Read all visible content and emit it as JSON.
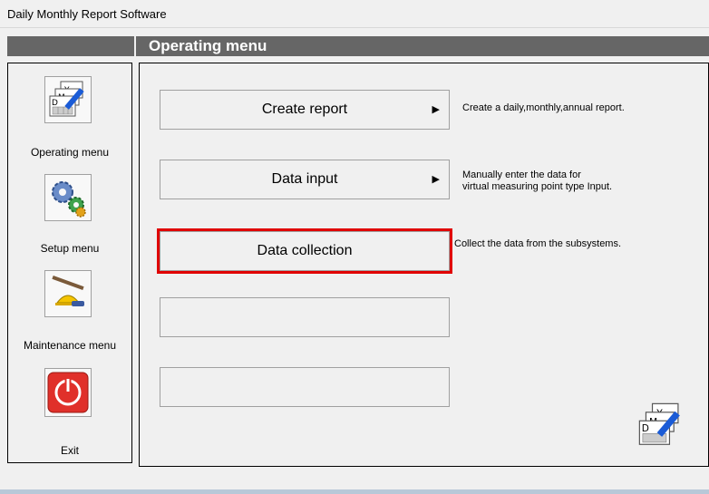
{
  "window": {
    "title": "Daily Monthly Report Software"
  },
  "header": {
    "title": "Operating menu"
  },
  "sidebar": {
    "items": [
      {
        "label": "Operating menu",
        "icon": "report-calendar-icon"
      },
      {
        "label": "Setup menu",
        "icon": "gears-icon"
      },
      {
        "label": "Maintenance menu",
        "icon": "tools-hardhat-icon"
      },
      {
        "label": "Exit",
        "icon": "power-icon"
      }
    ]
  },
  "main": {
    "buttons": [
      {
        "label": "Create report",
        "has_submenu": true,
        "description": "Create a daily,monthly,annual report."
      },
      {
        "label": "Data input",
        "has_submenu": true,
        "description_line1": "Manually enter the data for",
        "description_line2": "virtual measuring point type Input."
      },
      {
        "label": "Data collection",
        "has_submenu": false,
        "highlighted": true,
        "description": "Collect the data from the subsystems."
      },
      {
        "label": "",
        "has_submenu": false
      },
      {
        "label": "",
        "has_submenu": false
      }
    ],
    "submenu_arrow": "▶"
  },
  "colors": {
    "header_bg": "#666666",
    "highlight": "#e00000"
  }
}
